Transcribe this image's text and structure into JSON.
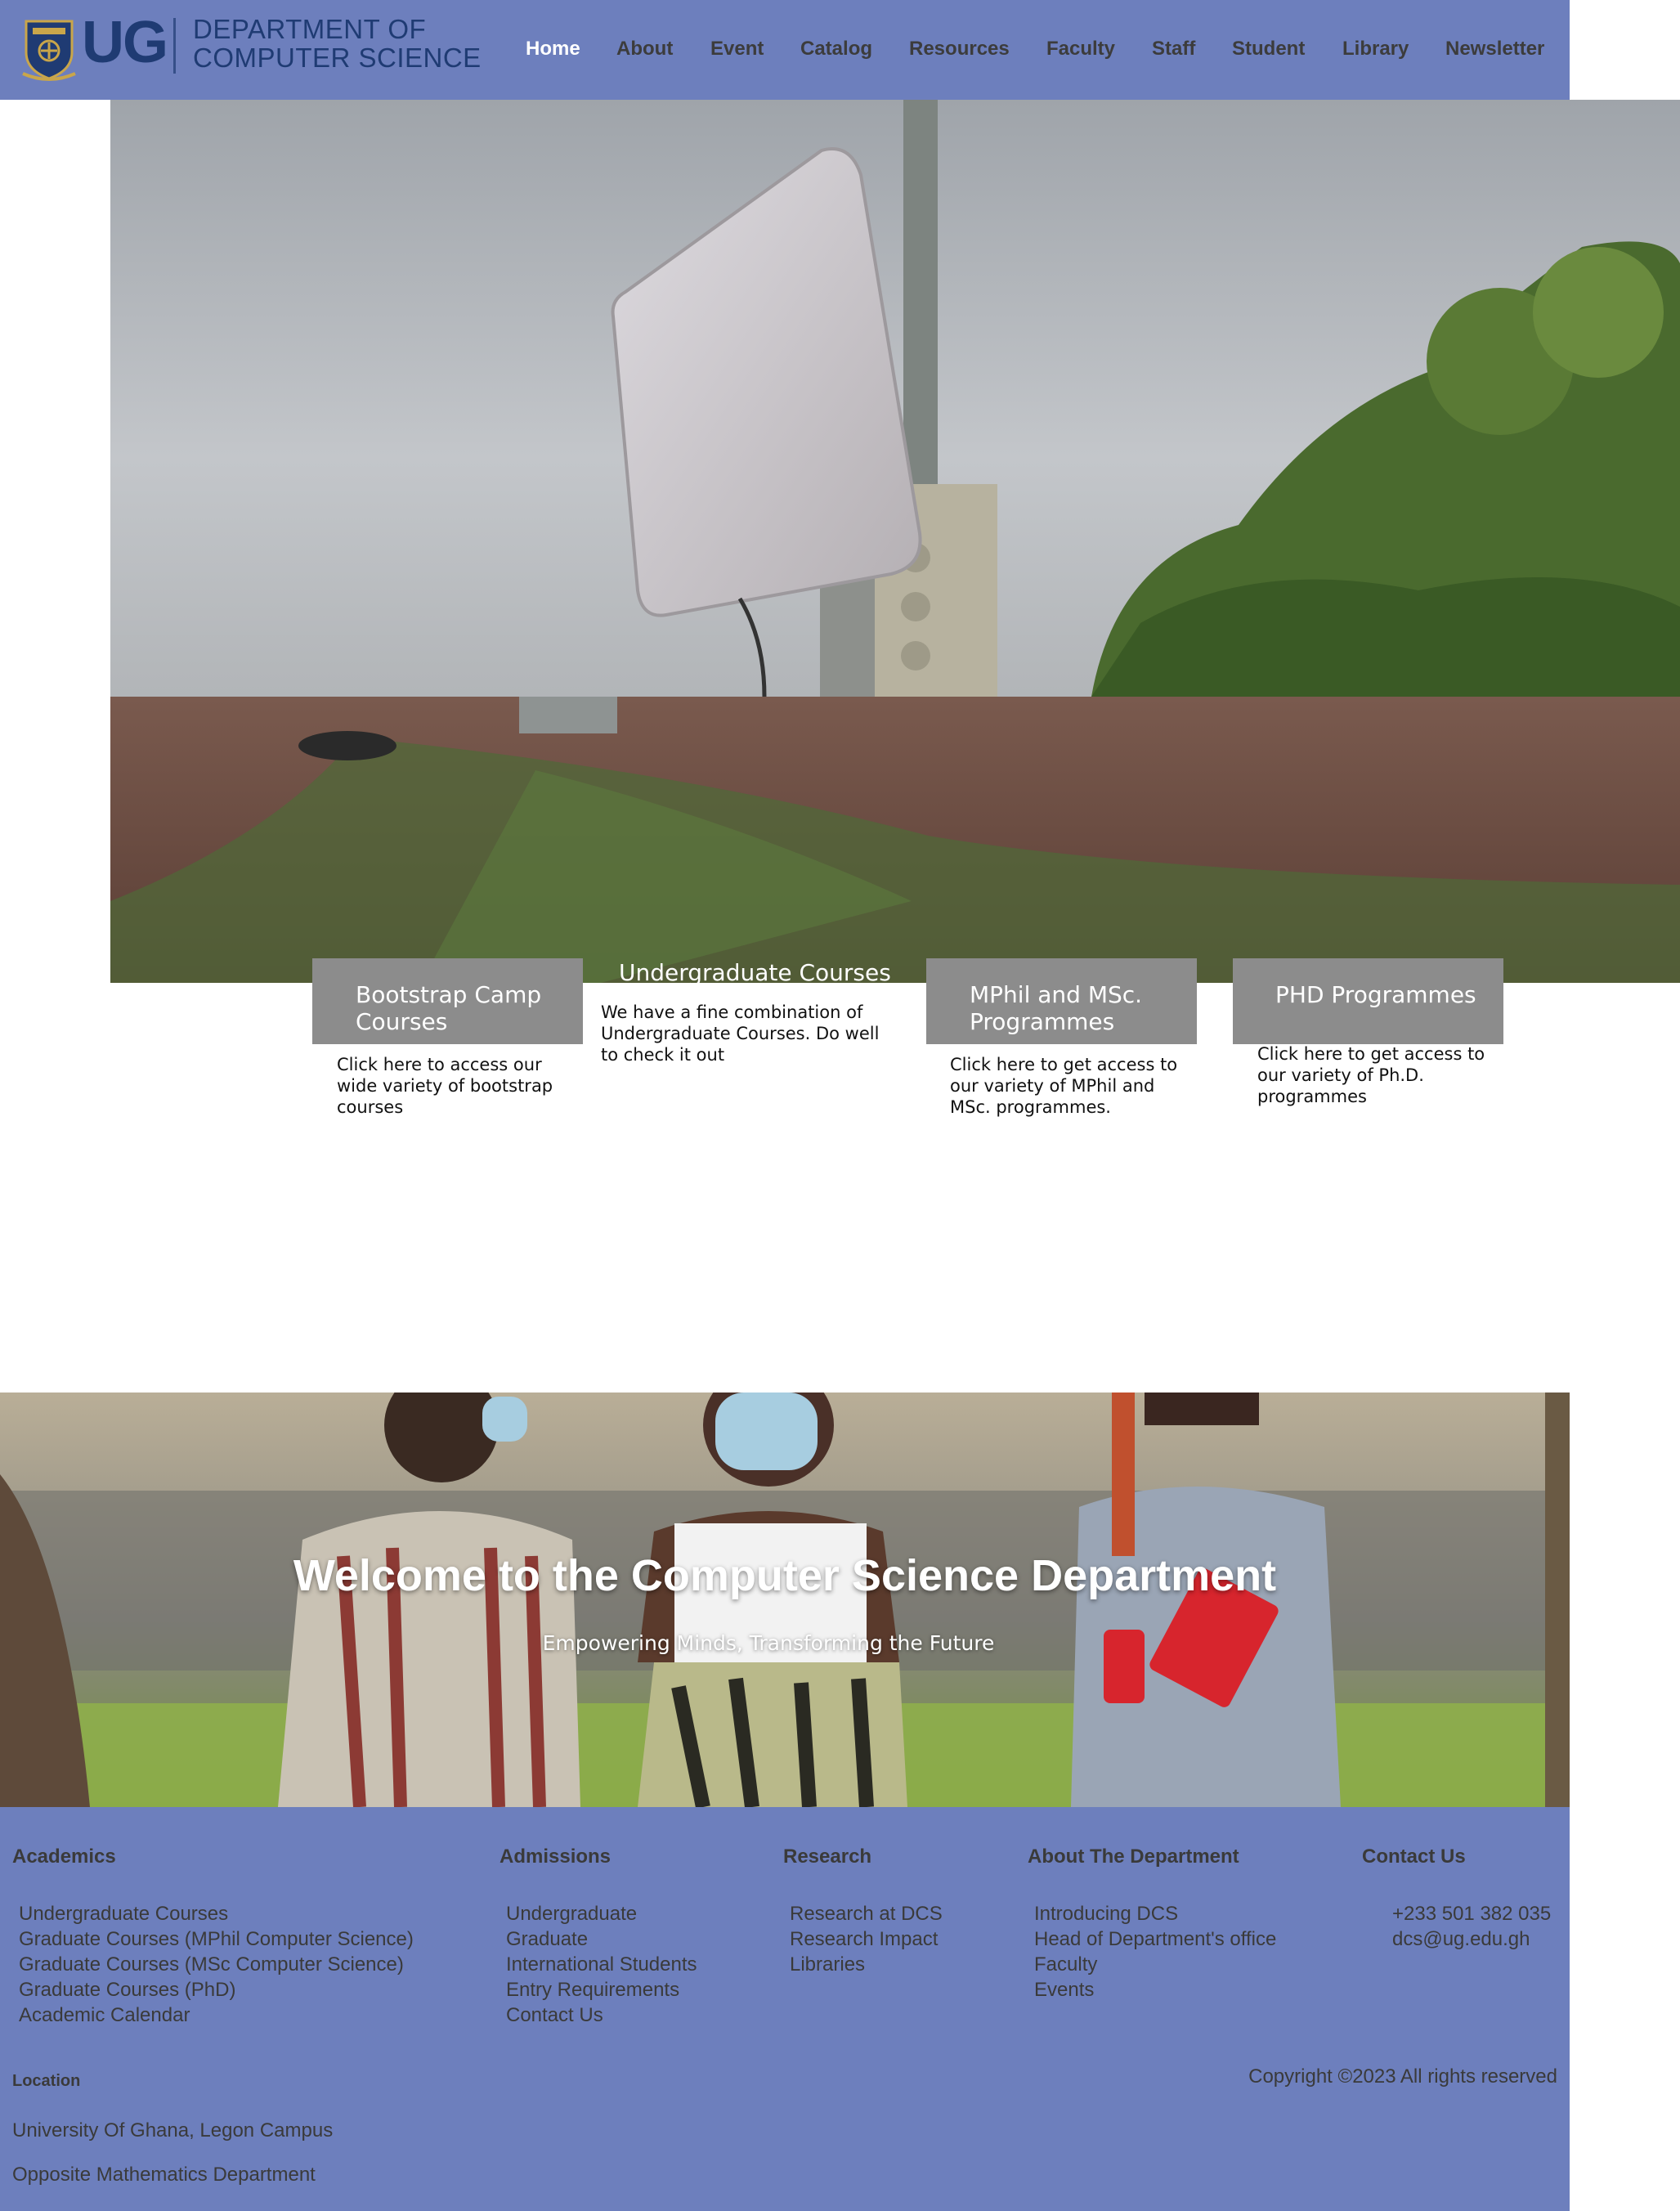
{
  "header": {
    "logo": {
      "mark": "UG",
      "dept_line1": "DEPARTMENT OF",
      "dept_line2": "COMPUTER SCIENCE"
    },
    "nav": [
      {
        "label": "Home",
        "active": true
      },
      {
        "label": "About"
      },
      {
        "label": "Event"
      },
      {
        "label": "Catalog"
      },
      {
        "label": "Resources"
      },
      {
        "label": "Faculty"
      },
      {
        "label": "Staff"
      },
      {
        "label": "Student"
      },
      {
        "label": "Library"
      },
      {
        "label": "Newsletter"
      }
    ]
  },
  "programs": [
    {
      "title": "Bootstrap Camp Courses",
      "text": "Click here to access our wide variety of bootstrap courses"
    },
    {
      "title": "Undergraduate Courses",
      "text": "We have a fine combination of Undergraduate Courses. Do well to check it out"
    },
    {
      "title": "MPhil and MSc. Programmes",
      "text": "Click here to get access to our variety of MPhil and MSc. programmes."
    },
    {
      "title": "PHD Programmes",
      "text": "Click here to get access to our variety of Ph.D. programmes"
    }
  ],
  "welcome": {
    "title": "Welcome to the Computer Science Department",
    "subtitle": "Empowering Minds, Transforming the Future"
  },
  "footer": {
    "academics": {
      "heading": "Academics",
      "links": [
        "Undergraduate Courses",
        "Graduate Courses (MPhil Computer Science)",
        "Graduate Courses (MSc Computer Science)",
        "Graduate Courses (PhD)",
        "Academic Calendar"
      ]
    },
    "admissions": {
      "heading": "Admissions",
      "links": [
        "Undergraduate",
        "Graduate",
        "International Students",
        "Entry Requirements",
        "Contact Us"
      ]
    },
    "research": {
      "heading": "Research",
      "links": [
        "Research at DCS",
        "Research Impact",
        "Libraries"
      ]
    },
    "about": {
      "heading": "About The Department",
      "links": [
        "Introducing DCS",
        "Head of Department's office",
        "Faculty",
        "Events"
      ]
    },
    "contact": {
      "heading": "Contact Us",
      "phone": "+233 501 382 035",
      "email": "dcs@ug.edu.gh"
    },
    "location": {
      "heading": "Location",
      "line1": "University Of Ghana, Legon Campus",
      "line2": "Opposite Mathematics Department"
    },
    "copyright": "Copyright ©2023 All rights reserved"
  },
  "colors": {
    "brand_blue": "#6d7fbd",
    "logo_navy": "#1f3b73",
    "card_gray": "#8c8c8c"
  }
}
